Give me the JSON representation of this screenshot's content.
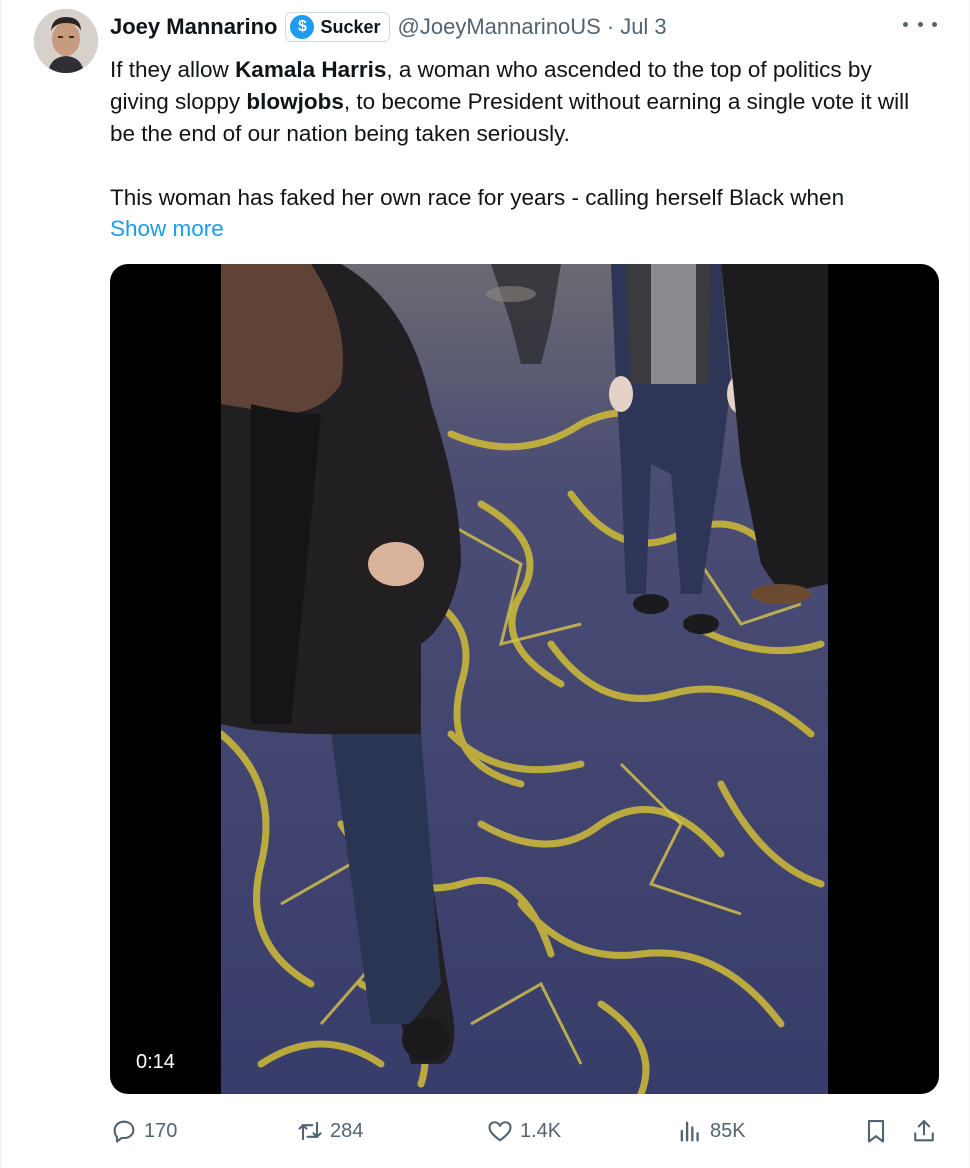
{
  "author": {
    "name": "Joey Mannarino",
    "handle": "@JoeyMannarinoUS",
    "separator": "·",
    "time": "Jul 3",
    "label": {
      "text": "Sucker",
      "icon": "dollar-sign-icon",
      "symbol": "$"
    }
  },
  "tweet": {
    "line1_pre": "If they allow ",
    "line1_bold": "Kamala Harris",
    "line1_mid": ", a woman who ascended to the top of politics by giving sloppy ",
    "line1_bold2": "blowjobs",
    "line1_post": ", to become President without earning a single vote it will be the end of our nation being taken seriously.",
    "line2": "This woman has faked her own race for years - calling herself Black when",
    "show_more": "Show more"
  },
  "media": {
    "duration": "0:14"
  },
  "stats": {
    "replies": "170",
    "reposts": "284",
    "likes": "1.4K",
    "views": "85K"
  },
  "colors": {
    "accent": "#1d9bf0",
    "text_primary": "#0f1419",
    "text_secondary": "#536471",
    "carpet_base": "#3a3f6a",
    "carpet_lines": "#c9b63a"
  }
}
